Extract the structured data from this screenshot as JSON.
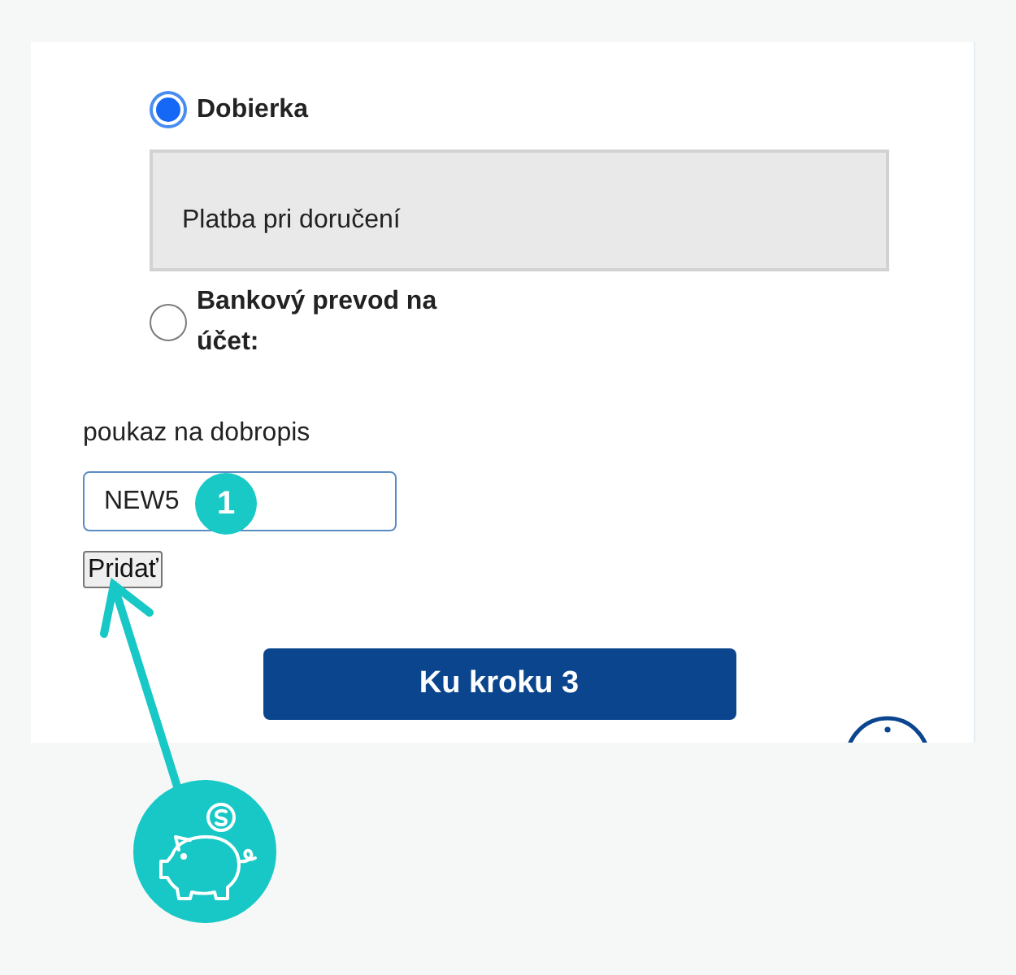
{
  "payment_options": [
    {
      "label": "Dobierka",
      "selected": true,
      "description": "Platba pri doručení"
    },
    {
      "label": "Bankový prevod na účet:",
      "selected": false
    }
  ],
  "voucher": {
    "label": "poukaz na dobropis",
    "value": "NEW5",
    "button": "Pridať"
  },
  "next_button": "Ku kroku 3",
  "annotation": {
    "step_badge": "1"
  }
}
